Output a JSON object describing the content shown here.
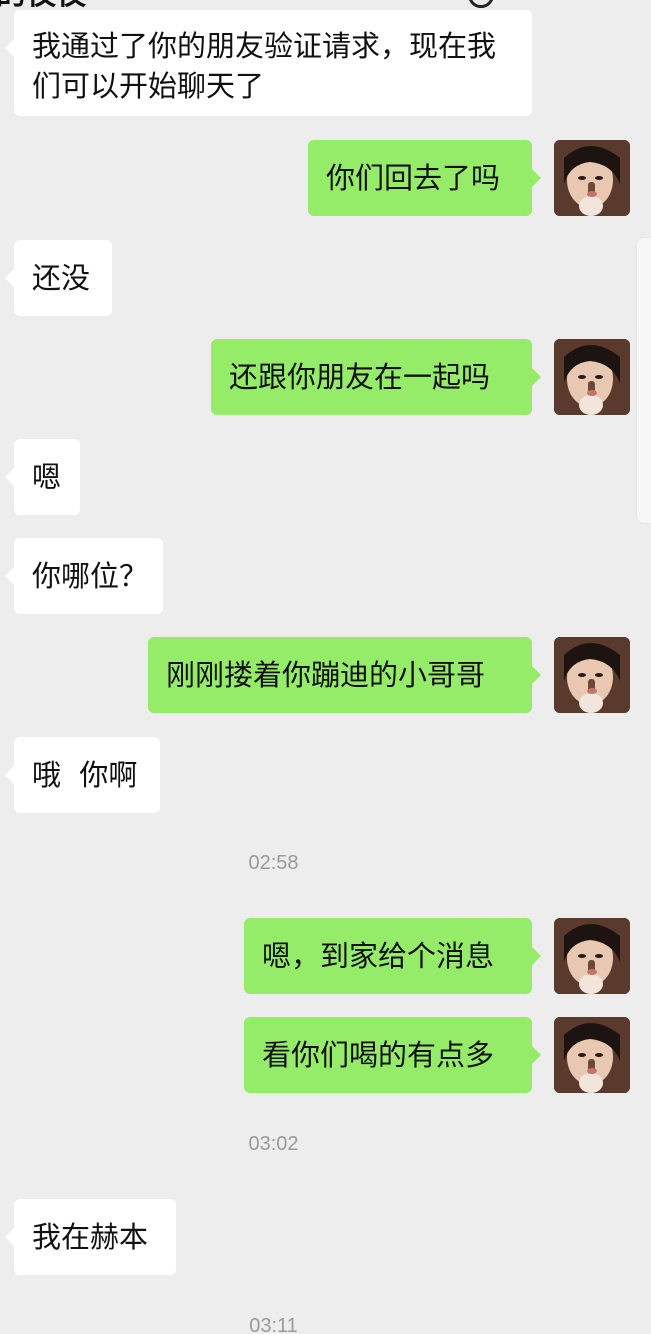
{
  "topbar": {
    "title_partial": "的夜夜",
    "icon": "search-icon"
  },
  "messages": [
    {
      "side": "in",
      "text": "我通过了你的朋友验证请求，现在我们可以开始聊天了"
    },
    {
      "side": "out",
      "text": "你们回去了吗",
      "avatar": "user-avatar"
    },
    {
      "side": "in",
      "text": "还没"
    },
    {
      "side": "out",
      "text": "还跟你朋友在一起吗",
      "avatar": "user-avatar"
    },
    {
      "side": "in",
      "text": "嗯"
    },
    {
      "side": "in",
      "text": "你哪位？"
    },
    {
      "side": "out",
      "text": "刚刚搂着你蹦迪的小哥哥",
      "avatar": "user-avatar"
    },
    {
      "side": "in",
      "text": "哦  你啊"
    },
    {
      "type": "timestamp",
      "text": "02:58"
    },
    {
      "side": "out",
      "text": "嗯，到家给个消息",
      "avatar": "user-avatar"
    },
    {
      "side": "out",
      "text": "看你们喝的有点多",
      "avatar": "user-avatar"
    },
    {
      "type": "timestamp",
      "text": "03:02"
    },
    {
      "side": "in",
      "text": "我在赫本"
    },
    {
      "type": "timestamp",
      "text": "03:11"
    }
  ],
  "colors": {
    "background": "#ededed",
    "incoming_bubble": "#ffffff",
    "outgoing_bubble": "#95ec69",
    "timestamp_text": "#9a9a9a"
  }
}
